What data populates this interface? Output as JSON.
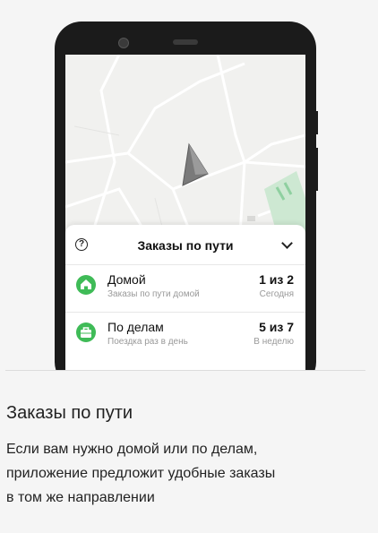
{
  "sheet": {
    "help_symbol": "?",
    "title": "Заказы по пути",
    "orders": [
      {
        "icon": "home-icon",
        "title": "Домой",
        "subtitle": "Заказы по пути домой",
        "count": "1 из 2",
        "when": "Сегодня"
      },
      {
        "icon": "briefcase-icon",
        "title": "По делам",
        "subtitle": "Поездка раз в день",
        "count": "5 из 7",
        "when": "В неделю"
      }
    ]
  },
  "content": {
    "title": "Заказы по пути",
    "text": "Если вам нужно домой или по делам,\nприложение предложит удобные заказы\nв том же направлении"
  },
  "colors": {
    "accent_green": "#3fbb57",
    "map_background": "#f1f1ef",
    "page_background": "#f5f5f5"
  }
}
